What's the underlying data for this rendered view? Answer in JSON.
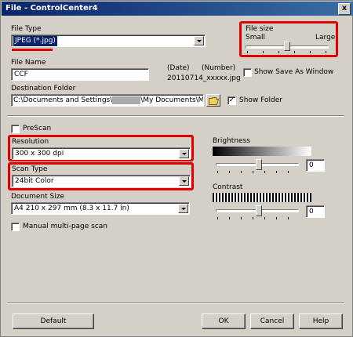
{
  "window": {
    "title": "File - ControlCenter4",
    "close_glyph": "x"
  },
  "file_type": {
    "label": "File Type",
    "value": "JPEG (*.jpg)"
  },
  "file_size": {
    "label": "File size",
    "small_label": "Small",
    "large_label": "Large",
    "level_percent": 55
  },
  "file_name": {
    "label": "File Name",
    "value": "CCF",
    "date_label": "(Date)",
    "number_label": "(Number)",
    "preview": "20110714_xxxxx.jpg"
  },
  "show_save_as": {
    "label": "Show Save As Window",
    "checked": false
  },
  "destination": {
    "label": "Destination Folder",
    "path_start": "C:\\Documents and Settings\\",
    "path_end": "\\My Documents\\My Pictur"
  },
  "show_folder": {
    "label": "Show Folder",
    "checked": true,
    "check_glyph": "✓"
  },
  "prescan": {
    "label": "PreScan",
    "checked": false
  },
  "resolution": {
    "label": "Resolution",
    "value": "300 x 300 dpi"
  },
  "scan_type": {
    "label": "Scan Type",
    "value": "24bit Color"
  },
  "document_size": {
    "label": "Document Size",
    "value": "A4 210 x 297 mm (8.3 x 11.7 in)"
  },
  "manual_multipage": {
    "label": "Manual multi-page scan",
    "checked": false
  },
  "brightness": {
    "label": "Brightness",
    "value": "0"
  },
  "contrast": {
    "label": "Contrast",
    "value": "0"
  },
  "buttons": {
    "default": "Default",
    "ok": "OK",
    "cancel": "Cancel",
    "help": "Help"
  },
  "colors": {
    "highlight": "#e00000",
    "selection": "#0a246a",
    "titlebar": "#0a246a"
  },
  "icons": {
    "close": "close-icon",
    "folder": "folder-icon"
  }
}
